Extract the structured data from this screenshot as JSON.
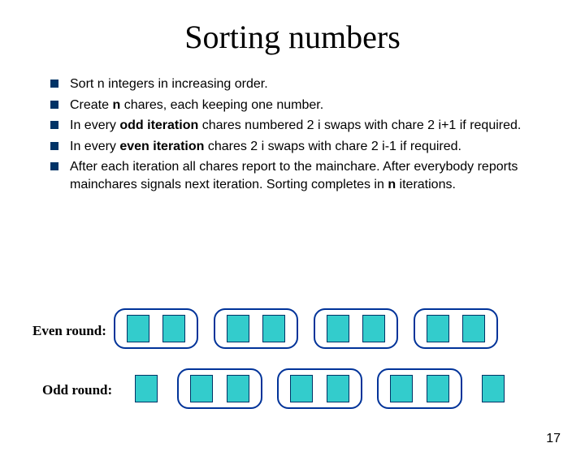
{
  "title": "Sorting numbers",
  "bullets": {
    "b1": "Sort n integers in increasing order.",
    "b2a": "Create ",
    "b2b": "n",
    "b2c": " chares, each keeping one number.",
    "b3a": "In every ",
    "b3b": "odd iteration",
    "b3c": " chares numbered 2 i swaps with chare 2 i+1 if required.",
    "b4a": "In every ",
    "b4b": "even iteration",
    "b4c": " chares 2 i swaps with chare 2 i-1 if required.",
    "b5a": "After each iteration all chares report to the mainchare. After everybody reports mainchares signals next iteration. Sorting completes in ",
    "b5b": "n",
    "b5c": " iterations."
  },
  "labels": {
    "even": "Even round:",
    "odd": "Odd round:"
  },
  "page_number": "17"
}
